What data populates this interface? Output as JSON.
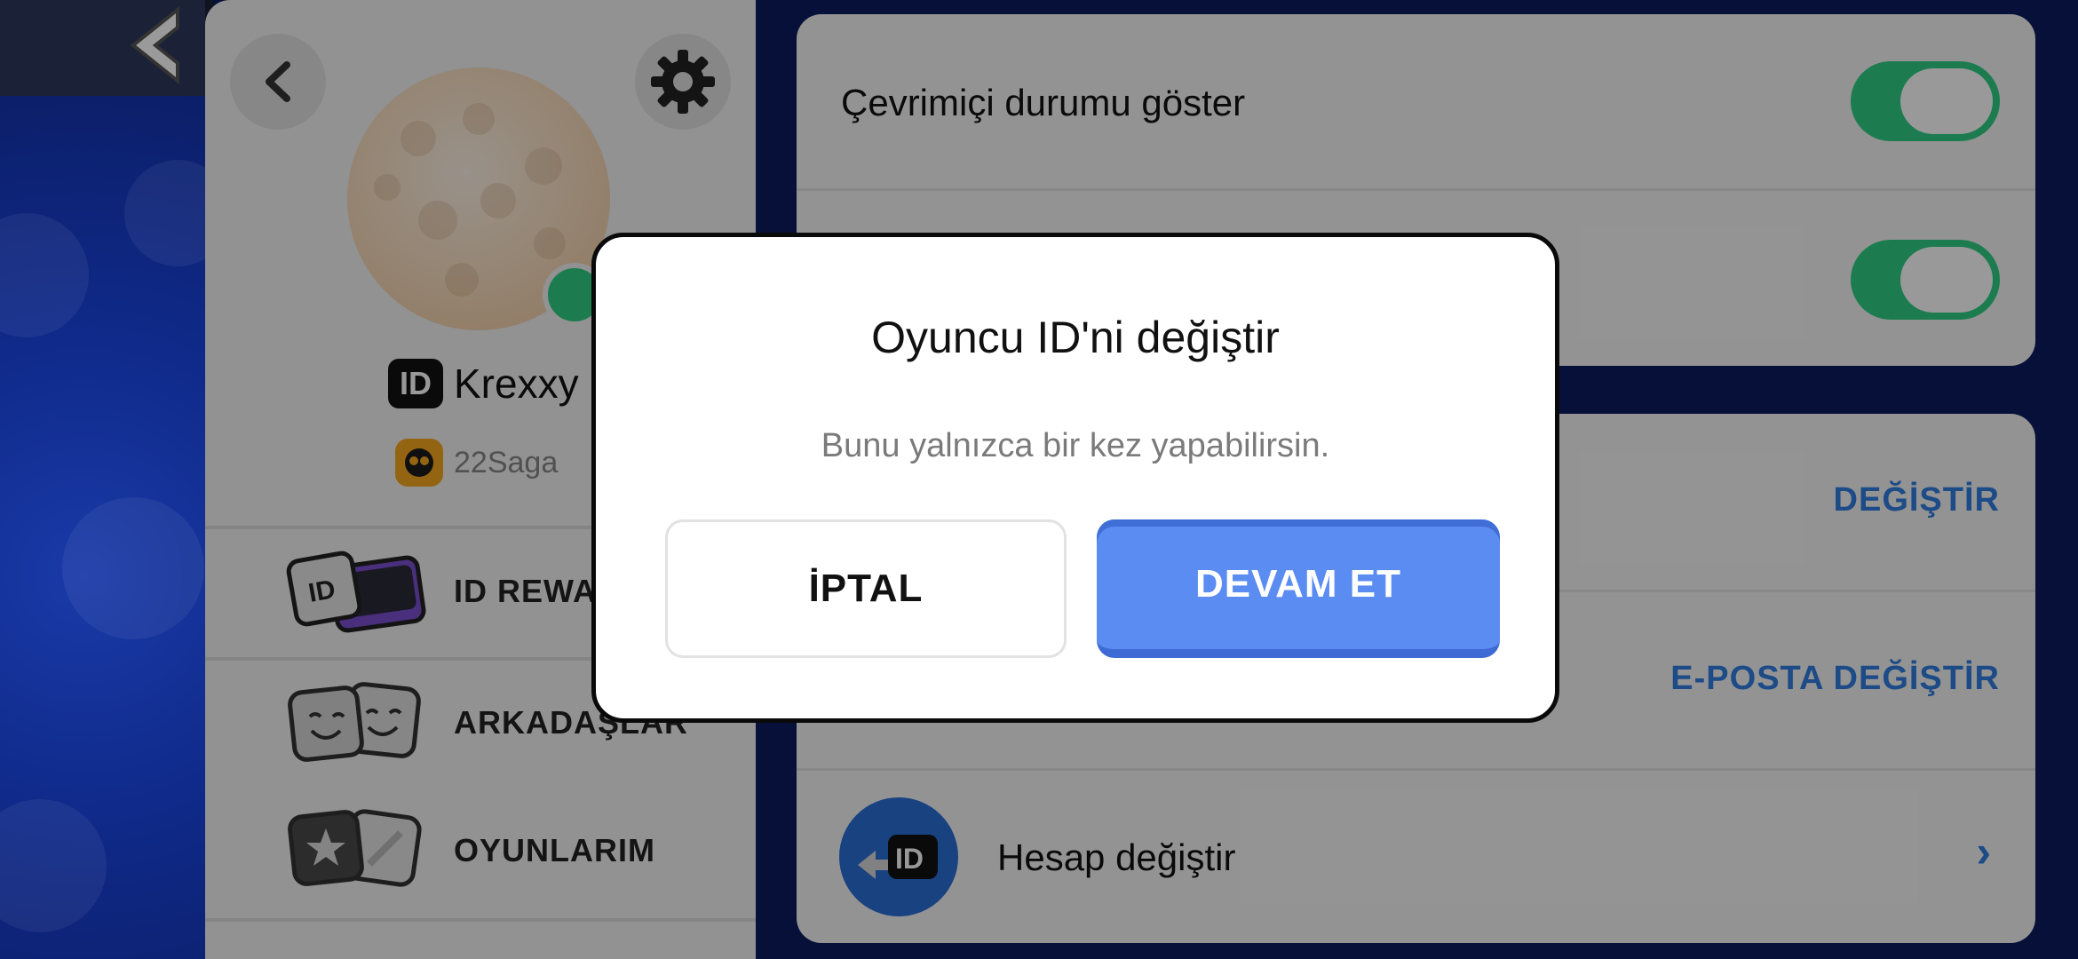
{
  "profile": {
    "name": "Krexxy",
    "id_badge": "ID",
    "club_name": "22Saga",
    "online_color": "#2fcf84"
  },
  "menu": {
    "items": [
      {
        "label": "ID REWA",
        "icon": "id-card-icon"
      },
      {
        "label": "ARKADAŞLAR",
        "icon": "friends-icon"
      },
      {
        "label": "OYUNLARIM",
        "icon": "games-icon"
      }
    ]
  },
  "settings": {
    "online_status_label": "Çevrimiçi durumu göster",
    "change_label": "DEĞİŞTİR",
    "change_email_label": "E-POSTA DEĞİŞTİR",
    "switch_account_label": "Hesap değiştir",
    "switch_account_icon_text": "ID",
    "toggle_color": "#2fcf84"
  },
  "dialog": {
    "title": "Oyuncu ID'ni değiştir",
    "message": "Bunu yalnızca bir kez yapabilirsin.",
    "cancel_label": "İPTAL",
    "continue_label": "DEVAM ET",
    "continue_color": "#5b8cf2"
  }
}
